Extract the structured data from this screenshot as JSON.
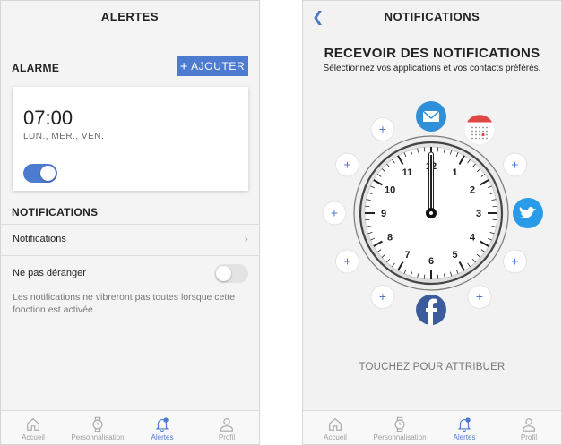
{
  "left_screen": {
    "title": "ALERTES",
    "alarm_section": "ALARME",
    "add_button": "AJOUTER",
    "alarm": {
      "time": "07:00",
      "days": "LUN., MER., VEN.",
      "enabled": true
    },
    "notifications_section": "NOTIFICATIONS",
    "notifications_row": "Notifications",
    "dnd_row": "Ne pas déranger",
    "dnd_enabled": false,
    "dnd_note": "Les notifications ne vibreront pas toutes lorsque cette fonction est activée."
  },
  "right_screen": {
    "title": "NOTIFICATIONS",
    "heading": "RECEVOIR DES NOTIFICATIONS",
    "subheading": "Sélectionnez vos applications et vos contacts préférés.",
    "dial_numbers": [
      "12",
      "1",
      "2",
      "3",
      "4",
      "5",
      "6",
      "7",
      "8",
      "9",
      "10",
      "11"
    ],
    "assigned_apps": [
      "mail-icon",
      "calendar-icon",
      "twitter-icon",
      "facebook-icon"
    ],
    "add_symbol": "+",
    "tap_to_assign": "TOUCHEZ POUR ATTRIBUER"
  },
  "tabbar": [
    {
      "label": "Accueil",
      "icon": "home-icon"
    },
    {
      "label": "Personnalisation",
      "icon": "watch-icon"
    },
    {
      "label": "Alertes",
      "icon": "bell-icon",
      "active": true
    },
    {
      "label": "Profil",
      "icon": "person-icon"
    }
  ],
  "colors": {
    "accent": "#4d7bd0",
    "mail": "#2f8fd8",
    "twitter": "#2a9be8",
    "facebook": "#3b5b9c",
    "calendar": "#e04646"
  }
}
